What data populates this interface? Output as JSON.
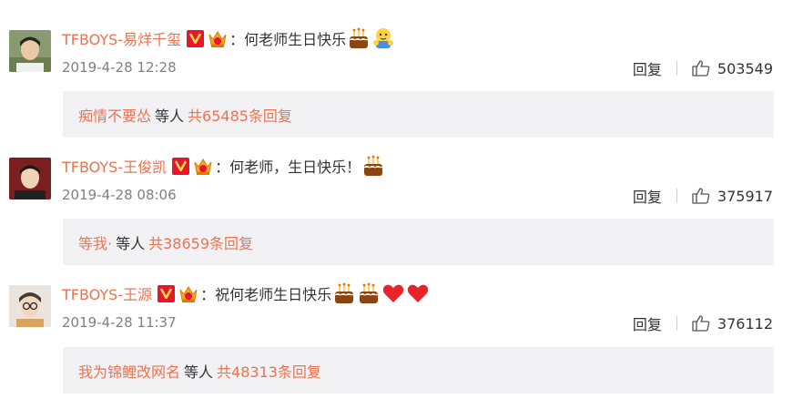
{
  "comments": [
    {
      "author": "TFBOYS-易烊千玺",
      "separator": "：",
      "text": "何老师生日快乐",
      "emojis": [
        "cake-emoji",
        "hug-emoji"
      ],
      "date": "2019-4-28 12:28",
      "reply_label": "回复",
      "like_count": "503549",
      "sub_reply": {
        "user": "痴情不要怂",
        "mid": "等人",
        "total": "共65485条回复"
      }
    },
    {
      "author": "TFBOYS-王俊凯",
      "separator": "：",
      "text": "何老师，生日快乐！",
      "emojis": [
        "cake-emoji"
      ],
      "date": "2019-4-28 08:06",
      "reply_label": "回复",
      "like_count": "375917",
      "sub_reply": {
        "user": "等我·",
        "mid": "等人",
        "total": "共38659条回复"
      }
    },
    {
      "author": "TFBOYS-王源",
      "separator": "：",
      "text": "祝何老师生日快乐",
      "emojis": [
        "cake-emoji",
        "cake-emoji",
        "heart-emoji",
        "heart-emoji"
      ],
      "date": "2019-4-28 11:37",
      "reply_label": "回复",
      "like_count": "376112",
      "sub_reply": {
        "user": "我为锦鲤改网名",
        "mid": "等人",
        "total": "共48313条回复"
      }
    }
  ],
  "colors": {
    "accent": "#eb7350",
    "verified_badge": "#e6162d",
    "reply_box_bg": "#f2f2f5",
    "date_text": "#808080"
  },
  "icons": [
    "verified-v-icon",
    "crown-member-icon",
    "thumb-up-icon",
    "avatar"
  ]
}
